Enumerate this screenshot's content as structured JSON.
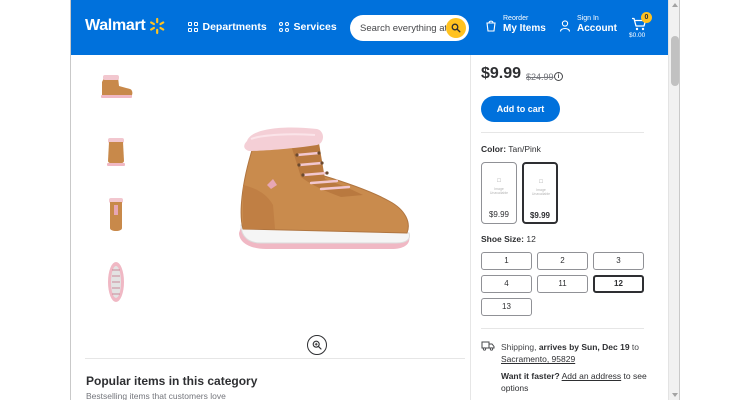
{
  "header": {
    "logo_text": "Walmart",
    "departments_label": "Departments",
    "services_label": "Services",
    "search_placeholder": "Search everything at Walmart online and in store",
    "reorder_small": "Reorder",
    "reorder_big": "My Items",
    "signin_small": "Sign In",
    "signin_big": "Account",
    "cart_count": "0",
    "cart_total": "$0.00",
    "brand_color": "#0071dc",
    "spark_color": "#ffc220"
  },
  "product": {
    "price": "$9.99",
    "was_price": "$24.99",
    "info_icon": "i",
    "add_to_cart": "Add to cart",
    "color_label": "Color:",
    "color_value": "Tan/Pink",
    "swatches": [
      {
        "price": "$9.99",
        "selected": false,
        "placeholder": "Image Unavailable"
      },
      {
        "price": "$9.99",
        "selected": true,
        "placeholder": "Image Unavailable"
      }
    ],
    "size_label": "Shoe Size:",
    "size_value": "12",
    "sizes": [
      "1",
      "2",
      "3",
      "4",
      "11",
      "12",
      "13"
    ],
    "selected_size": "12"
  },
  "shipping": {
    "prefix": "Shipping,",
    "arrives": "arrives by Sun, Dec 19",
    "to": "to",
    "location": "Sacramento, 95829",
    "want_faster": "Want it faster?",
    "add_address": "Add an address",
    "see_options": "to see options"
  },
  "popular": {
    "title": "Popular items in this category",
    "subtitle": "Bestselling items that customers love"
  }
}
